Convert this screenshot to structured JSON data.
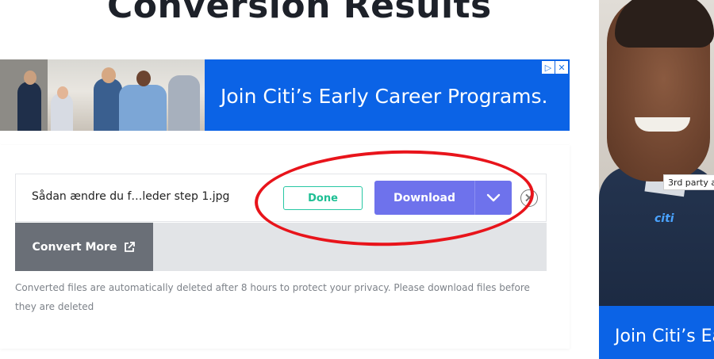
{
  "page": {
    "title": "Conversion Results"
  },
  "top_ad": {
    "headline": "Join Citi’s Early Career Programs.",
    "adchoices_icon": "adchoices-icon",
    "close_icon_glyph": "✕",
    "colors": {
      "background": "#0b63e6"
    }
  },
  "file_item": {
    "name": "Sådan ændre du f…leder step 1.jpg",
    "status": "Done",
    "download_label": "Download",
    "dropdown_icon": "chevron-down-icon",
    "remove_icon": "close-circle-icon"
  },
  "actions": {
    "convert_more_label": "Convert More",
    "convert_more_icon": "external-link-icon"
  },
  "notice": "Converted files are automatically deleted after 8 hours to protect your privacy. Please download files before they are deleted",
  "side_ad": {
    "badge": "3rd party a",
    "headline": "Join Citi’s Early",
    "logo": "citi"
  },
  "colors": {
    "accent": "#6e72ec",
    "done": "#1ebf94",
    "annotation": "#e8141b"
  }
}
